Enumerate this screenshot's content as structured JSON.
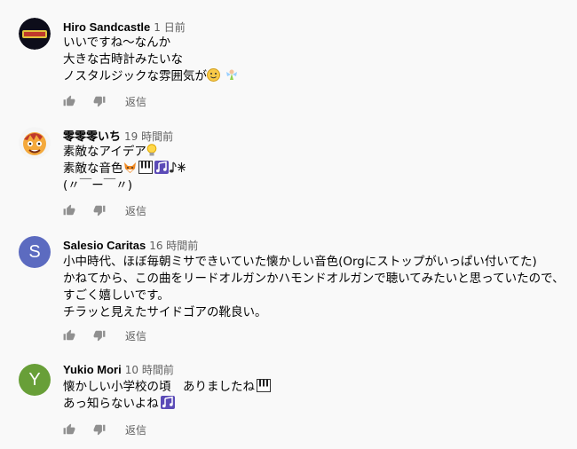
{
  "comments": [
    {
      "author": "Hiro Sandcastle",
      "time": "1 日前",
      "avatar_type": "image",
      "lines": [
        "いいですね～なんか",
        "大きな古時計みたいな",
        "ノスタルジックな雰囲気が"
      ],
      "reply_label": "返信"
    },
    {
      "author": "零零零いち",
      "time": "19 時間前",
      "avatar_type": "image",
      "lines": [
        "素敵なアイデア",
        "素敵な音色",
        "(〃￣ー￣〃)"
      ],
      "reply_label": "返信"
    },
    {
      "author": "Salesio Caritas",
      "time": "16 時間前",
      "avatar_type": "letter",
      "avatar_letter": "S",
      "avatar_color": "#5c6bc0",
      "lines": [
        "小中時代、ほぼ毎朝ミサできいていた懐かしい音色(Orgにストップがいっぱい付いてた)",
        "かねてから、この曲をリードオルガンかハモンドオルガンで聴いてみたいと思っていたので、",
        "すごく嬉しいです。",
        "チラッと見えたサイドゴアの靴良い。"
      ],
      "reply_label": "返信"
    },
    {
      "author": "Yukio Mori",
      "time": "10 時間前",
      "avatar_type": "letter",
      "avatar_letter": "Y",
      "avatar_color": "#689f38",
      "lines": [
        "懐かしい小学校の頃　ありましたね",
        "あっ知らないよね"
      ],
      "reply_label": "返信"
    }
  ]
}
